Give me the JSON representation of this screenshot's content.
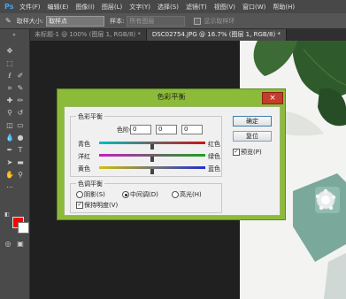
{
  "app": {
    "logo": "Ps"
  },
  "menu": [
    "文件(F)",
    "编辑(E)",
    "图像(I)",
    "图层(L)",
    "文字(Y)",
    "选择(S)",
    "滤镜(T)",
    "视图(V)",
    "窗口(W)",
    "帮助(H)"
  ],
  "options": {
    "size_label": "取样大小:",
    "size_value": "取样点",
    "sample_label": "样本:",
    "sample_value": "所有图层",
    "show_ring": "显示取样环"
  },
  "tabs": [
    {
      "label": "未标题-1 @ 100% (图层 1, RGB/8) *"
    },
    {
      "label": "DSC02754.JPG @ 16.7% (图层 1, RGB/8) *"
    }
  ],
  "dialog": {
    "title": "色彩平衡",
    "close": "×",
    "balance_group": "色彩平衡",
    "levels_label": "色阶(L):",
    "levels": [
      "0",
      "0",
      "0"
    ],
    "sliders": [
      {
        "left": "青色",
        "right": "红色",
        "value": 0
      },
      {
        "left": "洋红",
        "right": "绿色",
        "value": 0
      },
      {
        "left": "黄色",
        "right": "蓝色",
        "value": 0
      }
    ],
    "tone_group": "色调平衡",
    "tone_options": [
      "阴影(S)",
      "中间调(D)",
      "高光(H)"
    ],
    "tone_selected": "中间调(D)",
    "preserve_luminosity": "保持明度(V)",
    "preserve_checked": true,
    "ok": "确定",
    "reset": "复位",
    "preview": "预览(P)",
    "preview_checked": true
  }
}
